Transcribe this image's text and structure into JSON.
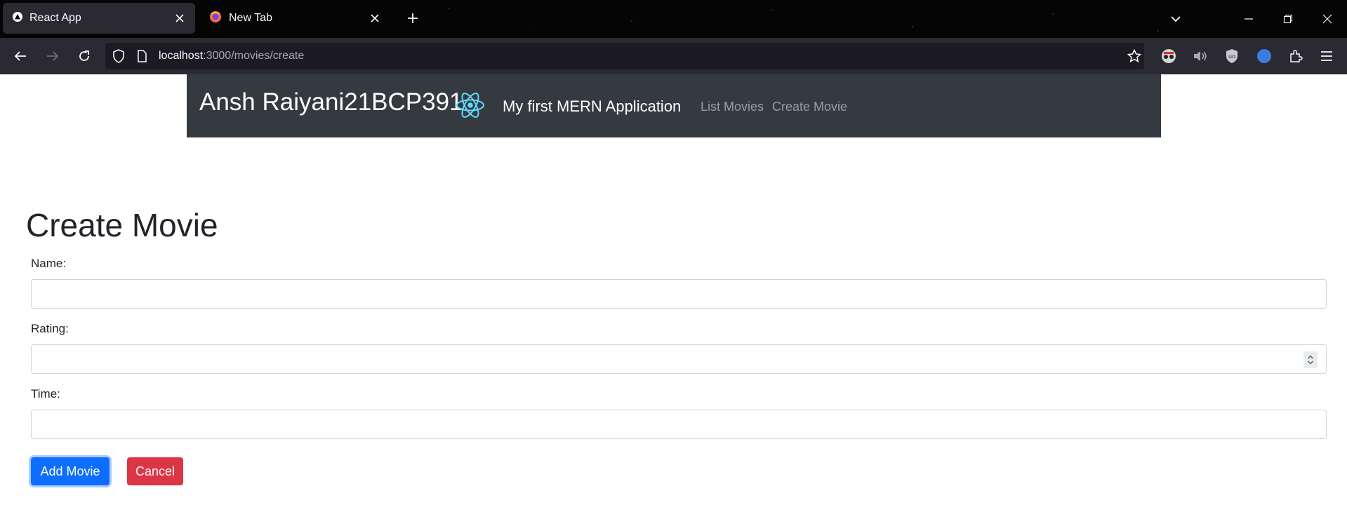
{
  "browser": {
    "tabs": [
      {
        "title": "React App",
        "active": true
      },
      {
        "title": "New Tab",
        "active": false
      }
    ],
    "url_host": "localhost",
    "url_path": ":3000/movies/create",
    "colors": {
      "chrome_bg": "#2b2a33",
      "tabbar_bg": "#050505"
    }
  },
  "app_nav": {
    "brand": "Ansh Raiyani21BCP391",
    "app_title": "My first MERN Application",
    "links": [
      "List Movies",
      "Create Movie"
    ],
    "logo_icon": "react-logo-icon",
    "colors": {
      "bg": "#343a40",
      "link": "#9a9da1",
      "logo": "#61dafb"
    }
  },
  "page": {
    "title": "Create Movie",
    "fields": [
      {
        "label": "Name:",
        "value": "",
        "type": "text"
      },
      {
        "label": "Rating:",
        "value": "",
        "type": "number"
      },
      {
        "label": "Time:",
        "value": "",
        "type": "text"
      }
    ],
    "buttons": {
      "add": "Add Movie",
      "cancel": "Cancel"
    },
    "colors": {
      "primary": "#0d6efd",
      "danger": "#dc3545"
    }
  }
}
